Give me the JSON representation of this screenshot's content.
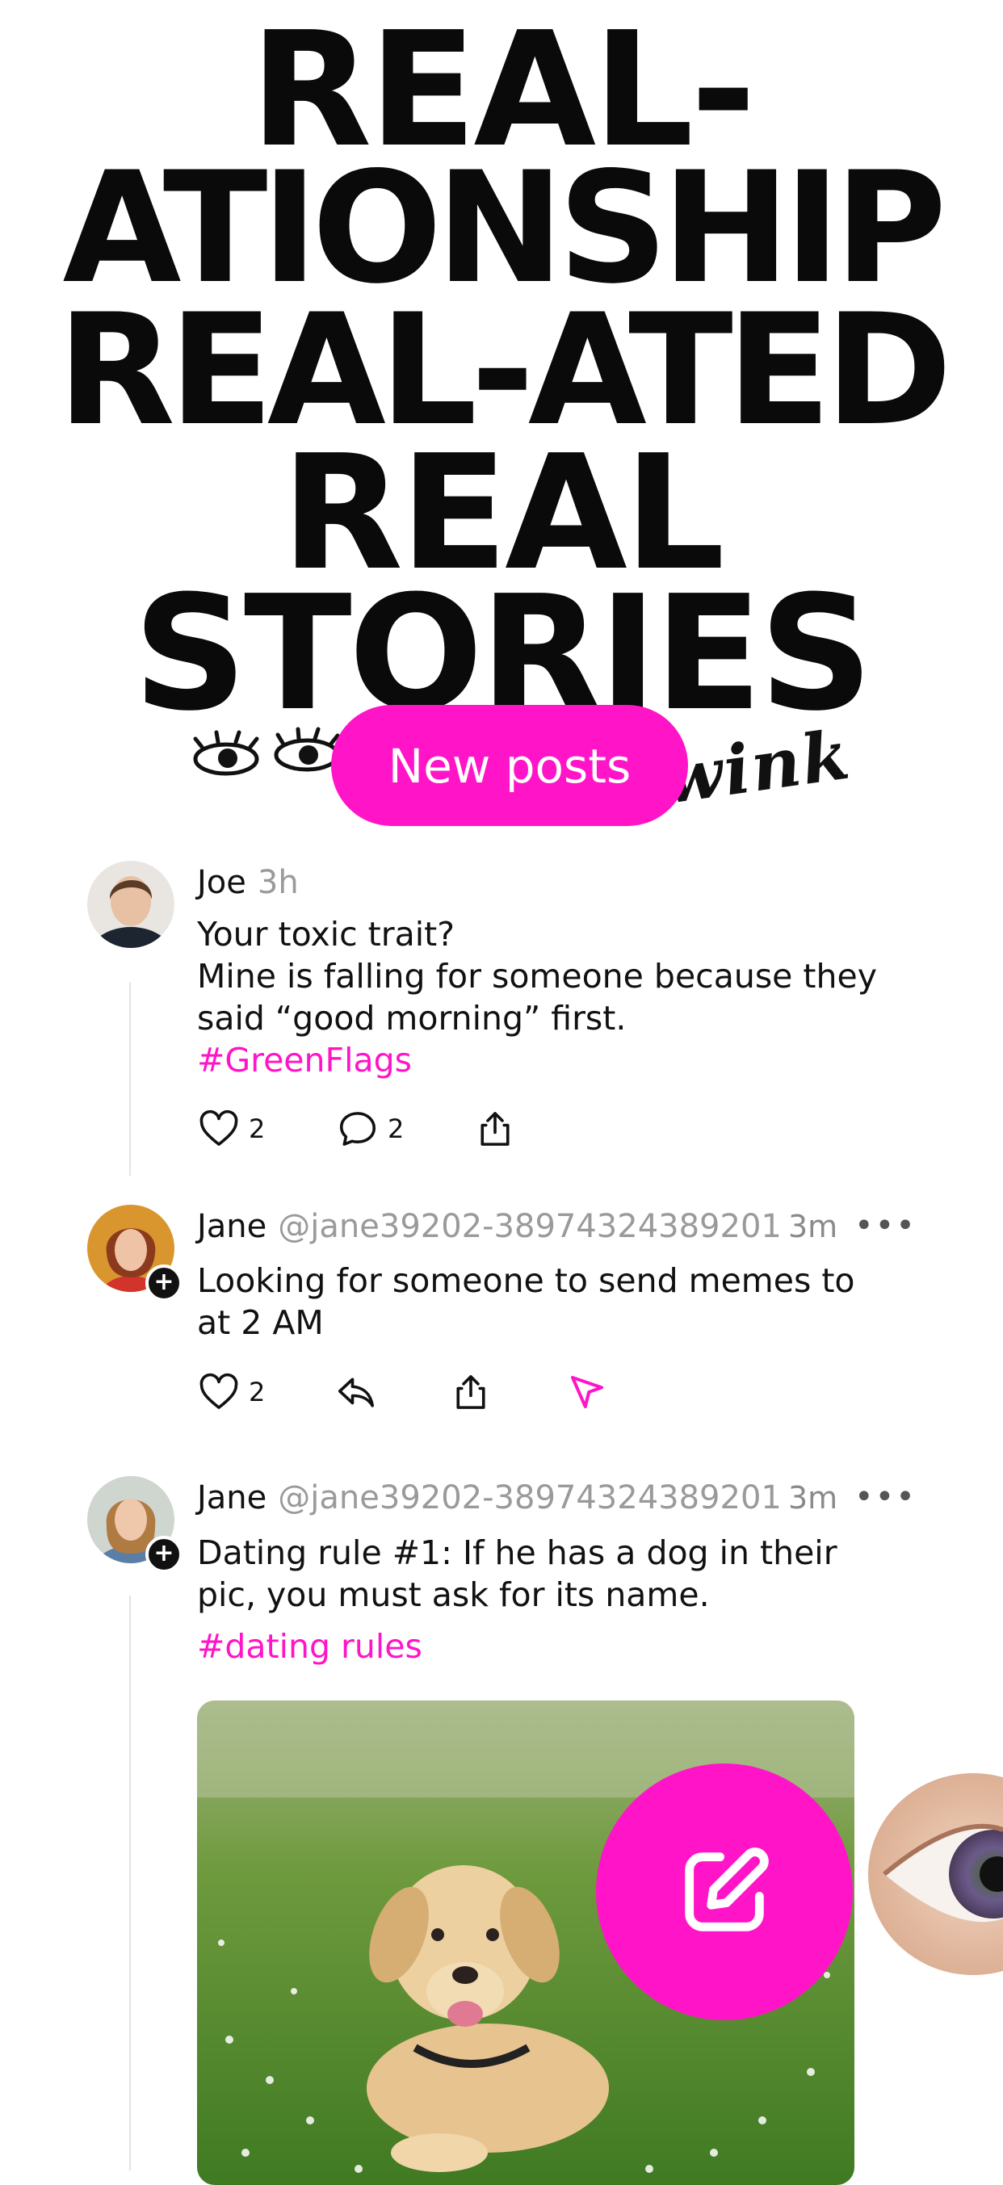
{
  "headline": {
    "line1": "REAL-",
    "line2": "ATIONSHIP",
    "line3": "REAL-ATED",
    "line4": "REAL",
    "line5": "STORIES"
  },
  "doodle_word": "wink",
  "new_posts_label": "New posts",
  "colors": {
    "accent": "#ff14c8",
    "text": "#111111",
    "muted": "#9a9a9a"
  },
  "posts": [
    {
      "name": "Joe",
      "time": "3h",
      "lines": [
        "Your toxic trait?",
        "Mine is falling for someone because they",
        "said “good morning” first."
      ],
      "hashtag": "#GreenFlags",
      "likes": "2",
      "comments": "2"
    },
    {
      "name": "Jane",
      "handle": "@jane39202-38974324389201",
      "time": "3m",
      "more": "•••",
      "lines": [
        "Looking for someone to send memes to",
        "at 2 AM"
      ],
      "likes": "2"
    },
    {
      "name": "Jane",
      "handle": "@jane39202-38974324389201",
      "time": "3m",
      "more": "•••",
      "lines": [
        "Dating rule #1: If he has a dog in their",
        "pic, you must ask for its name."
      ],
      "hashtag": "#dating rules"
    }
  ],
  "icons": [
    "heart-icon",
    "comment-icon",
    "share-icon",
    "reply-icon",
    "send-icon",
    "compose-icon",
    "follow-plus-icon",
    "more-icon"
  ]
}
